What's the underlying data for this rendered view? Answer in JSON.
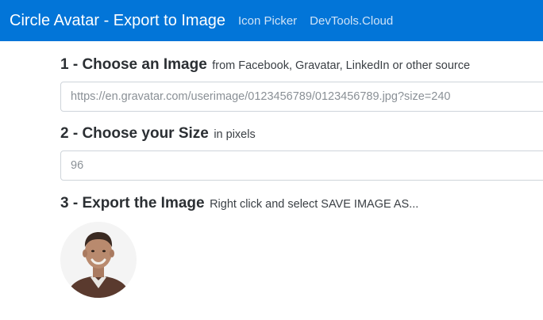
{
  "nav": {
    "brand": "Circle Avatar - Export to Image",
    "links": [
      "Icon Picker",
      "DevTools.Cloud"
    ]
  },
  "steps": [
    {
      "title": "1 - Choose an Image",
      "hint": "from Facebook, Gravatar, LinkedIn or other source",
      "input_placeholder": "https://en.gravatar.com/userimage/0123456789/0123456789.jpg?size=240",
      "input_value": ""
    },
    {
      "title": "2 - Choose your Size",
      "hint": "in pixels",
      "input_placeholder": "96",
      "input_value": ""
    },
    {
      "title": "3 - Export the Image",
      "hint": "Right click and select SAVE IMAGE AS..."
    }
  ],
  "avatar": {
    "icon": "person-photo-icon",
    "colors": {
      "background": "#f4f4f4",
      "skin": "#b98a6e",
      "hair": "#3a2a22",
      "jacket": "#5a3a2e",
      "shirt": "#e8e6e2"
    }
  }
}
